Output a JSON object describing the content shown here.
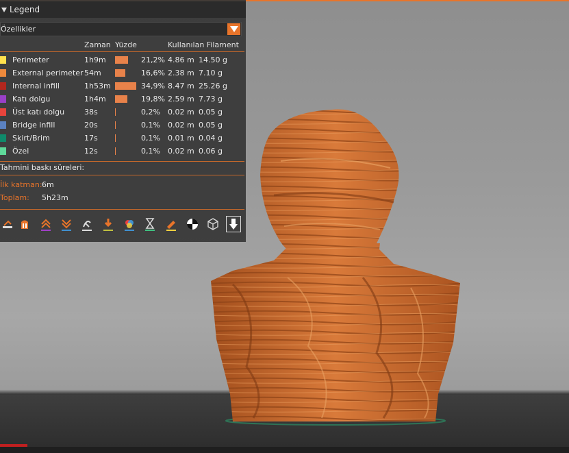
{
  "legend": {
    "title": "Legend",
    "dropdown_value": "Özellikler",
    "columns": {
      "time": "Zaman",
      "percent": "Yüzde",
      "filament": "Kullanılan Filament"
    },
    "rows": [
      {
        "color": "#ffe14d",
        "label": "Perimeter",
        "time": "1h9m",
        "percent": "21,2%",
        "pct": 21.2,
        "length": "4.86 m",
        "weight": "14.50 g"
      },
      {
        "color": "#ef8a3c",
        "label": "External perimeter",
        "time": "54m",
        "percent": "16,6%",
        "pct": 16.6,
        "length": "2.38 m",
        "weight": "7.10 g"
      },
      {
        "color": "#b3271e",
        "label": "Internal infill",
        "time": "1h53m",
        "percent": "34,9%",
        "pct": 34.9,
        "length": "8.47 m",
        "weight": "25.26 g"
      },
      {
        "color": "#9a40c8",
        "label": "Katı dolgu",
        "time": "1h4m",
        "percent": "19,8%",
        "pct": 19.8,
        "length": "2.59 m",
        "weight": "7.73 g"
      },
      {
        "color": "#e8443c",
        "label": "Üst katı dolgu",
        "time": "38s",
        "percent": "0,2%",
        "pct": 0.2,
        "length": "0.02 m",
        "weight": "0.05 g"
      },
      {
        "color": "#5b82c2",
        "label": "Bridge infill",
        "time": "20s",
        "percent": "0,1%",
        "pct": 0.1,
        "length": "0.02 m",
        "weight": "0.05 g"
      },
      {
        "color": "#0f8a6a",
        "label": "Skirt/Brim",
        "time": "17s",
        "percent": "0,1%",
        "pct": 0.1,
        "length": "0.01 m",
        "weight": "0.04 g"
      },
      {
        "color": "#5fd99a",
        "label": "Özel",
        "time": "12s",
        "percent": "0,1%",
        "pct": 0.1,
        "length": "0.02 m",
        "weight": "0.06 g"
      }
    ],
    "estimate_title": "Tahmini baskı süreleri:",
    "first_layer_label": "İlk katman:",
    "first_layer_value": "6m",
    "total_label": "Toplam:",
    "total_value": "5h23m"
  },
  "toolbar_icons": [
    "travel-icon",
    "wipe-icon",
    "retractions-icon",
    "deretractions-icon",
    "seams-icon",
    "tool-changes-icon",
    "color-changes-icon",
    "pause-prints-icon",
    "custom-gcodes-icon",
    "center-of-gravity-icon",
    "shells-icon",
    "tool-marker-icon"
  ],
  "colors": {
    "accent": "#e8742a",
    "panel_bg": "#383838",
    "model_orange": "#c8692a"
  }
}
